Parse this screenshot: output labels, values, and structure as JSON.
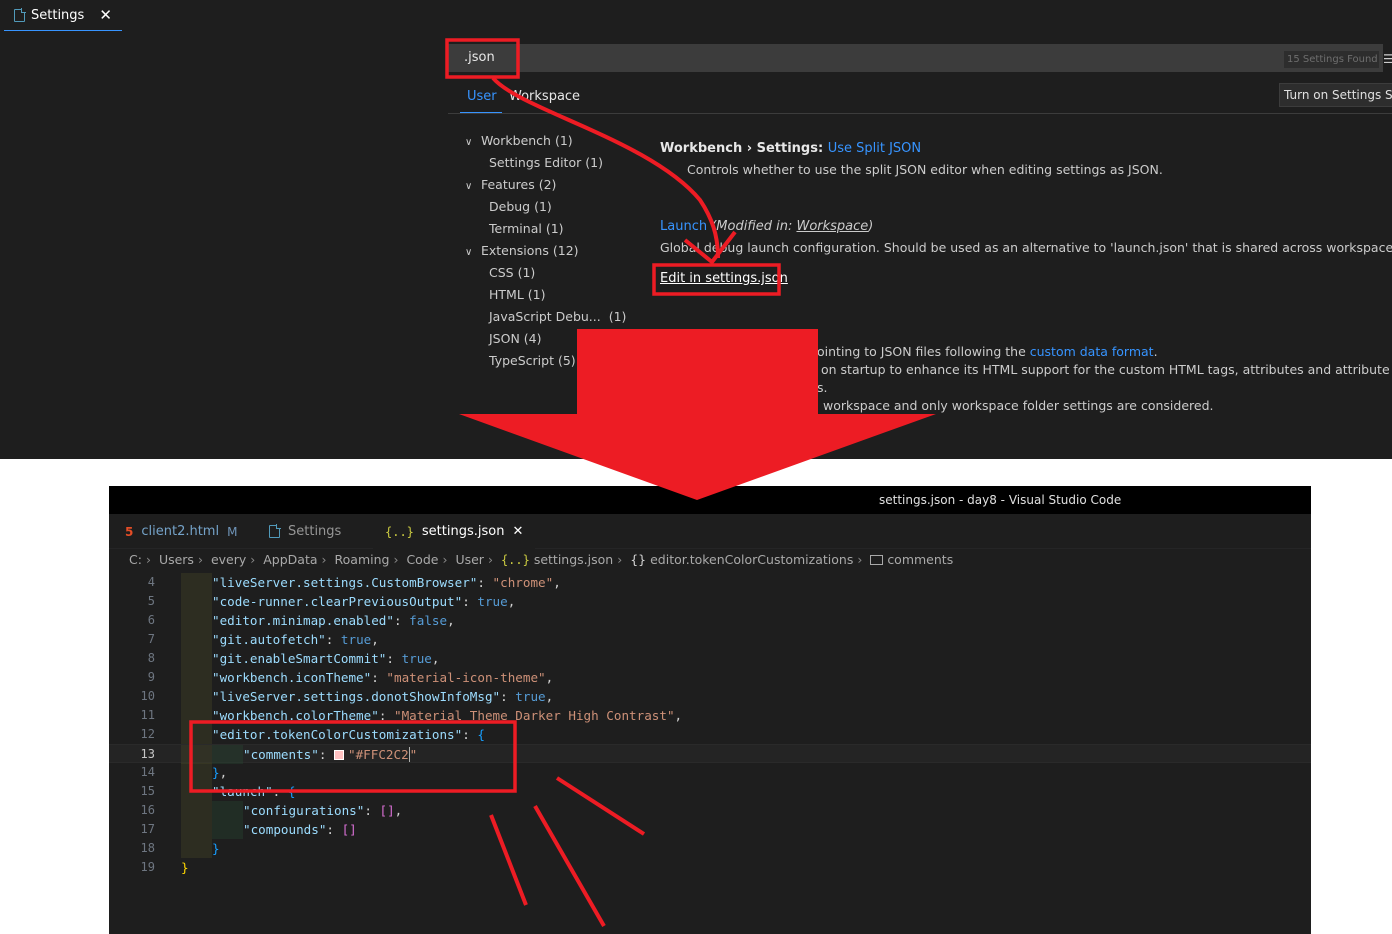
{
  "settings_editor": {
    "tab_label": "Settings",
    "tab_close": "✕",
    "search_value": ".json",
    "settings_found": "15 Settings Found",
    "scope_tabs": [
      "User",
      "Workspace"
    ],
    "sync_button": "Turn on Settings Sy",
    "toc": [
      {
        "label": "Workbench",
        "count": "(1)",
        "expandable": true
      },
      {
        "label": "Settings Editor",
        "count": "(1)",
        "expandable": false
      },
      {
        "label": "Features",
        "count": "(2)",
        "expandable": true
      },
      {
        "label": "Debug",
        "count": "(1)",
        "expandable": false
      },
      {
        "label": "Terminal",
        "count": "(1)",
        "expandable": false
      },
      {
        "label": "Extensions",
        "count": "(12)",
        "expandable": true
      },
      {
        "label": "CSS",
        "count": "(1)",
        "expandable": false
      },
      {
        "label": "HTML",
        "count": "(1)",
        "expandable": false
      },
      {
        "label": "JavaScript Debu...",
        "count": "(1)",
        "expandable": false
      },
      {
        "label": "JSON",
        "count": "(4)",
        "expandable": false
      },
      {
        "label": "TypeScript",
        "count": "(5)",
        "expandable": false
      }
    ],
    "setting1": {
      "category": "Workbench › Settings: ",
      "name": "Use Split JSON",
      "description": "Controls whether to use the split JSON editor when editing settings as JSON."
    },
    "setting2": {
      "name": "Launch",
      "modified_prefix": " (Modified in: ",
      "modified_scope": "Workspace",
      "modified_suffix": ")",
      "description": "Global debug launch configuration. Should be used as an alternative to 'launch.json' that is shared across workspaces.",
      "edit_link": "Edit in settings.json"
    },
    "partial_lines": [
      {
        "before": "ointing to JSON files following the ",
        "link": "custom data format",
        "after": "."
      },
      {
        "before": "on startup to enhance its HTML support for the custom HTML tags, attributes and attribute values",
        "link": "",
        "after": ""
      },
      {
        "before": "s.",
        "link": "",
        "after": ""
      },
      {
        "before": "workspace and only workspace folder settings are considered.",
        "link": "",
        "after": ""
      }
    ]
  },
  "vscode_window": {
    "title": "settings.json - day8 - Visual Studio Code",
    "tabs": [
      {
        "icon": "html5-icon",
        "label": "client2.html",
        "badge": "M"
      },
      {
        "icon": "file-icon",
        "label": "Settings",
        "badge": ""
      },
      {
        "icon": "braces-icon",
        "label": "settings.json",
        "badge": "✕"
      }
    ],
    "breadcrumb": [
      "C:",
      "Users",
      "every",
      "AppData",
      "Roaming",
      "Code",
      "User",
      "settings.json",
      "editor.tokenColorCustomizations",
      "comments"
    ],
    "code_lines": [
      {
        "n": "4",
        "key": "\"liveServer.settings.CustomBrowser\"",
        "val": "\"chrome\"",
        "vtype": "s",
        "end": ","
      },
      {
        "n": "5",
        "key": "\"code-runner.clearPreviousOutput\"",
        "val": "true",
        "vtype": "v",
        "end": ","
      },
      {
        "n": "6",
        "key": "\"editor.minimap.enabled\"",
        "val": "false",
        "vtype": "v",
        "end": ","
      },
      {
        "n": "7",
        "key": "\"git.autofetch\"",
        "val": "true",
        "vtype": "v",
        "end": ","
      },
      {
        "n": "8",
        "key": "\"git.enableSmartCommit\"",
        "val": "true",
        "vtype": "v",
        "end": ","
      },
      {
        "n": "9",
        "key": "\"workbench.iconTheme\"",
        "val": "\"material-icon-theme\"",
        "vtype": "s",
        "end": ","
      },
      {
        "n": "10",
        "key": "\"liveServer.settings.donotShowInfoMsg\"",
        "val": "true",
        "vtype": "v",
        "end": ","
      },
      {
        "n": "11",
        "key": "\"workbench.colorTheme\"",
        "val": "\"Material Theme Darker High Contrast\"",
        "vtype": "s",
        "end": ","
      },
      {
        "n": "12",
        "key": "\"editor.tokenColorCustomizations\"",
        "val": "{",
        "vtype": "b3",
        "end": ""
      },
      {
        "n": "13",
        "key": "\"comments\"",
        "val": "\"#FFC2C2\"",
        "vtype": "s",
        "end": ""
      },
      {
        "n": "14",
        "key": "",
        "val": "}",
        "vtype": "b3",
        "end": ","
      },
      {
        "n": "15",
        "key": "\"launch\"",
        "val": "{",
        "vtype": "b3",
        "end": ""
      },
      {
        "n": "16",
        "key": "\"configurations\"",
        "val": "[]",
        "vtype": "b1",
        "end": ","
      },
      {
        "n": "17",
        "key": "\"compounds\"",
        "val": "[]",
        "vtype": "b1",
        "end": ""
      },
      {
        "n": "18",
        "key": "",
        "val": "}",
        "vtype": "b3",
        "end": ""
      },
      {
        "n": "19",
        "key": "",
        "val": "}",
        "vtype": "b2",
        "end": ""
      }
    ],
    "comment_color": "#FFC2C2"
  },
  "annotation_color": "#ed1c24"
}
